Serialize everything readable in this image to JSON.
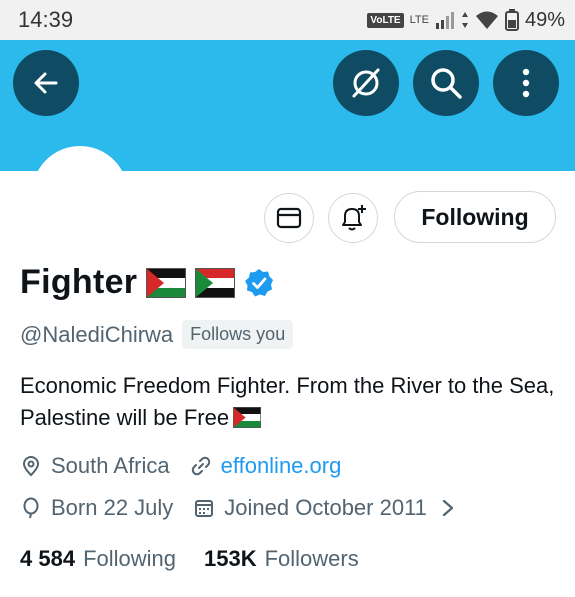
{
  "status_bar": {
    "time": "14:39",
    "volte": "VoLTE",
    "lte": "LTE",
    "battery": "49%"
  },
  "header": {
    "back_icon": "arrow-left-icon",
    "grok_icon": "grok-icon",
    "search_icon": "search-icon",
    "more_icon": "more-vertical-icon",
    "banner_color": "#2cbaec",
    "button_color": "#0f4c63"
  },
  "actions": {
    "following_label": "Following"
  },
  "profile": {
    "name": "Fighter",
    "handle": "@NalediChirwa",
    "follows_you": "Follows you",
    "bio": "Economic Freedom Fighter. From the River to the Sea, Palestine will be Free",
    "location": "South Africa",
    "website": "effonline.org",
    "born": "Born 22 July",
    "joined": "Joined October 2011",
    "following_count": "4 584",
    "following_label": "Following",
    "followers_count": "153K",
    "followers_label": "Followers"
  },
  "colors": {
    "accent": "#1d9bf0",
    "muted": "#536471",
    "text": "#0f1419"
  }
}
